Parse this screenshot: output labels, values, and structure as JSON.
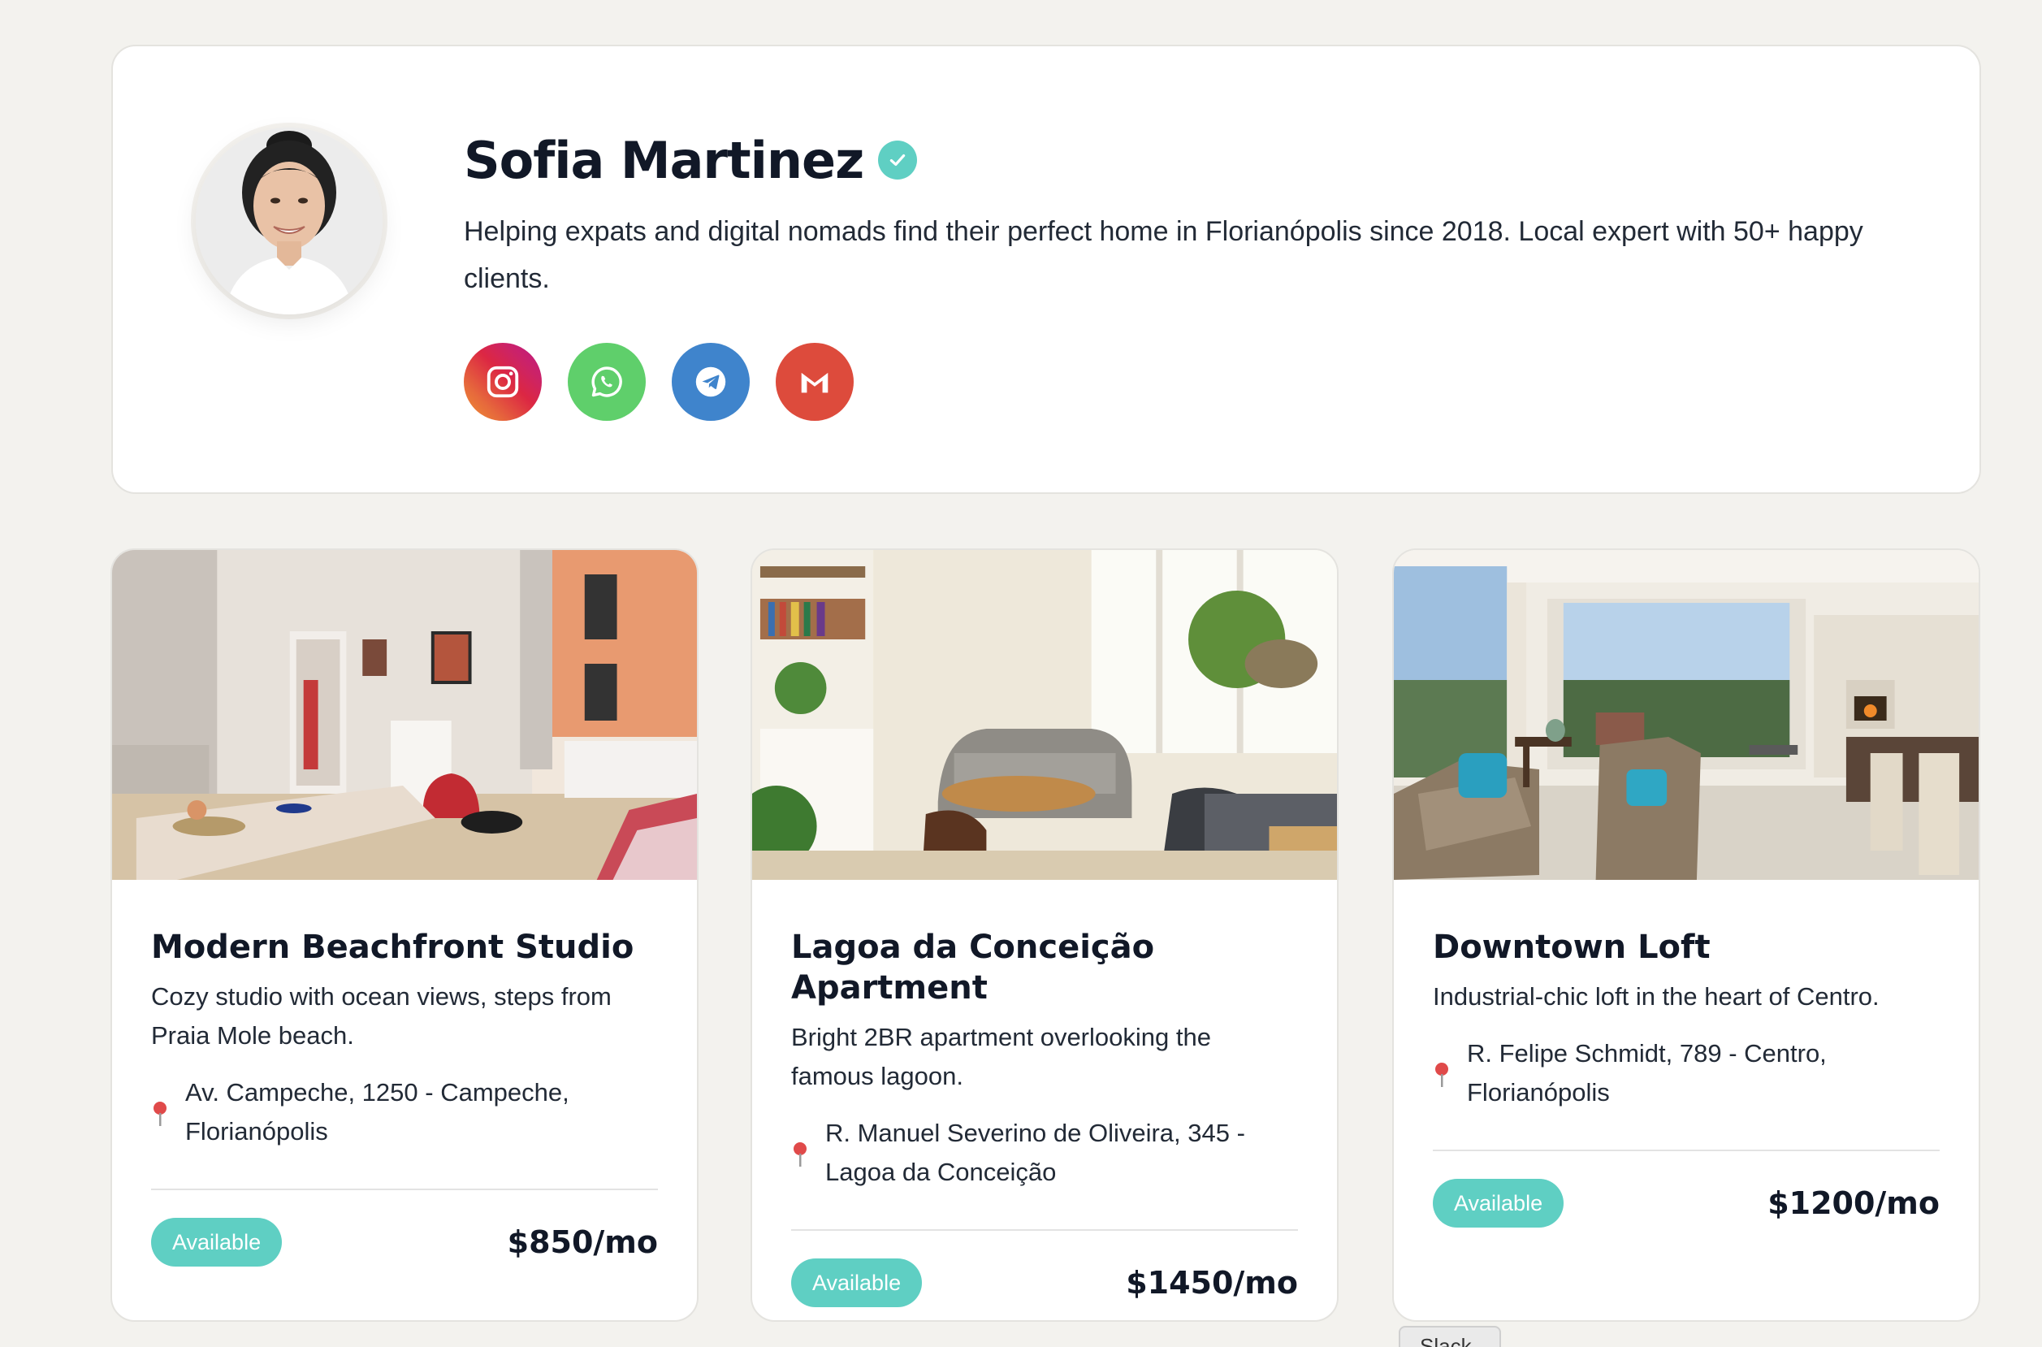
{
  "profile": {
    "name": "Sofia Martinez",
    "verified": true,
    "bio": "Helping expats and digital nomads find their perfect home in Florianópolis since 2018. Local expert with 50+ happy clients.",
    "socials": [
      {
        "name": "instagram",
        "icon": "instagram-icon",
        "color": "#e1306c"
      },
      {
        "name": "whatsapp",
        "icon": "whatsapp-icon",
        "color": "#5fcf6b"
      },
      {
        "name": "telegram",
        "icon": "telegram-icon",
        "color": "#3f84cc"
      },
      {
        "name": "gmail",
        "icon": "gmail-icon",
        "color": "#dd4b3c"
      }
    ]
  },
  "listings": [
    {
      "title": "Modern Beachfront Studio",
      "description": "Cozy studio with ocean views, steps from Praia Mole beach.",
      "address": "Av. Campeche, 1250 - Campeche, Florianópolis",
      "status": "Available",
      "price": "$850/mo"
    },
    {
      "title": "Lagoa da Conceição Apartment",
      "description": "Bright 2BR apartment overlooking the famous lagoon.",
      "address": "R. Manuel Severino de Oliveira, 345 - Lagoa da Conceição",
      "status": "Available",
      "price": "$1450/mo"
    },
    {
      "title": "Downtown Loft",
      "description": "Industrial-chic loft in the heart of Centro.",
      "address": "R. Felipe Schmidt, 789 - Centro, Florianópolis",
      "status": "Available",
      "price": "$1200/mo"
    }
  ],
  "tooltip": "Slack",
  "colors": {
    "accent": "#5fcfc3",
    "background": "#f3f2ee",
    "pin": "#e04a4a"
  }
}
